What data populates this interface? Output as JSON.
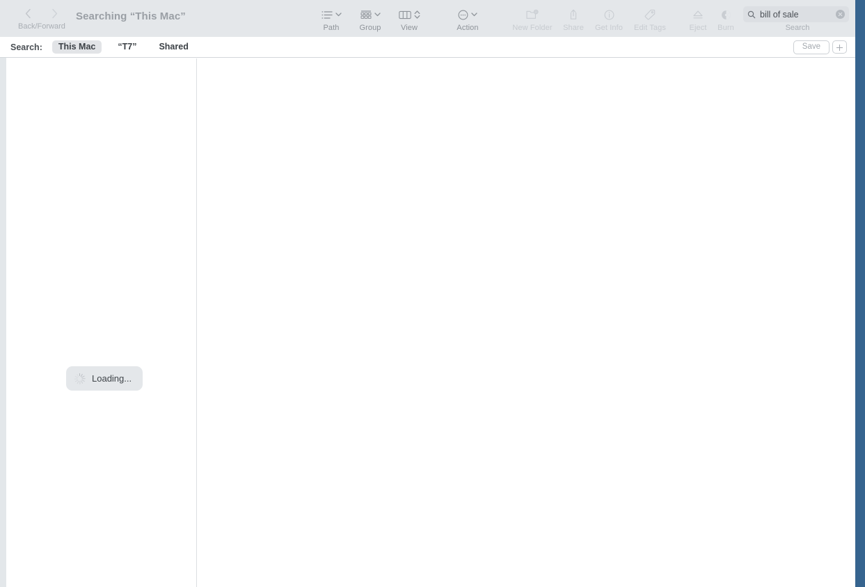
{
  "window": {
    "title": "Searching “This Mac”",
    "accent_blue": "#36648f",
    "toolbar_bg": "#e4e7ea"
  },
  "toolbar": {
    "nav": {
      "label": "Back/Forward",
      "back_icon": "chevron-left-icon",
      "forward_icon": "chevron-right-icon"
    },
    "items": [
      {
        "label": "Path",
        "icon": "path-list-icon",
        "enabled": true
      },
      {
        "label": "Group",
        "icon": "grid-group-icon",
        "enabled": true
      },
      {
        "label": "View",
        "icon": "column-view-icon",
        "enabled": true
      },
      {
        "label": "Action",
        "icon": "action-circle-icon",
        "enabled": true
      },
      {
        "label": "New Folder",
        "icon": "new-folder-icon",
        "enabled": false
      },
      {
        "label": "Share",
        "icon": "share-icon",
        "enabled": false
      },
      {
        "label": "Get Info",
        "icon": "info-circle-icon",
        "enabled": false
      },
      {
        "label": "Edit Tags",
        "icon": "tag-icon",
        "enabled": false
      },
      {
        "label": "Eject",
        "icon": "eject-icon",
        "enabled": false
      },
      {
        "label": "Burn",
        "icon": "burn-disc-icon",
        "enabled": false
      }
    ],
    "search": {
      "label": "Search",
      "value": "bill of sale",
      "placeholder": "Search",
      "icon": "search-icon",
      "clear_icon": "clear-circle-icon"
    }
  },
  "scope_bar": {
    "label": "Search:",
    "chips": [
      {
        "label": "This Mac",
        "selected": true
      },
      {
        "label": "“T7”",
        "selected": false
      },
      {
        "label": "Shared",
        "selected": false
      }
    ],
    "save_label": "Save",
    "add_icon": "plus-icon"
  },
  "content": {
    "loading": {
      "label": "Loading...",
      "spinner_icon": "spinner-icon"
    }
  }
}
